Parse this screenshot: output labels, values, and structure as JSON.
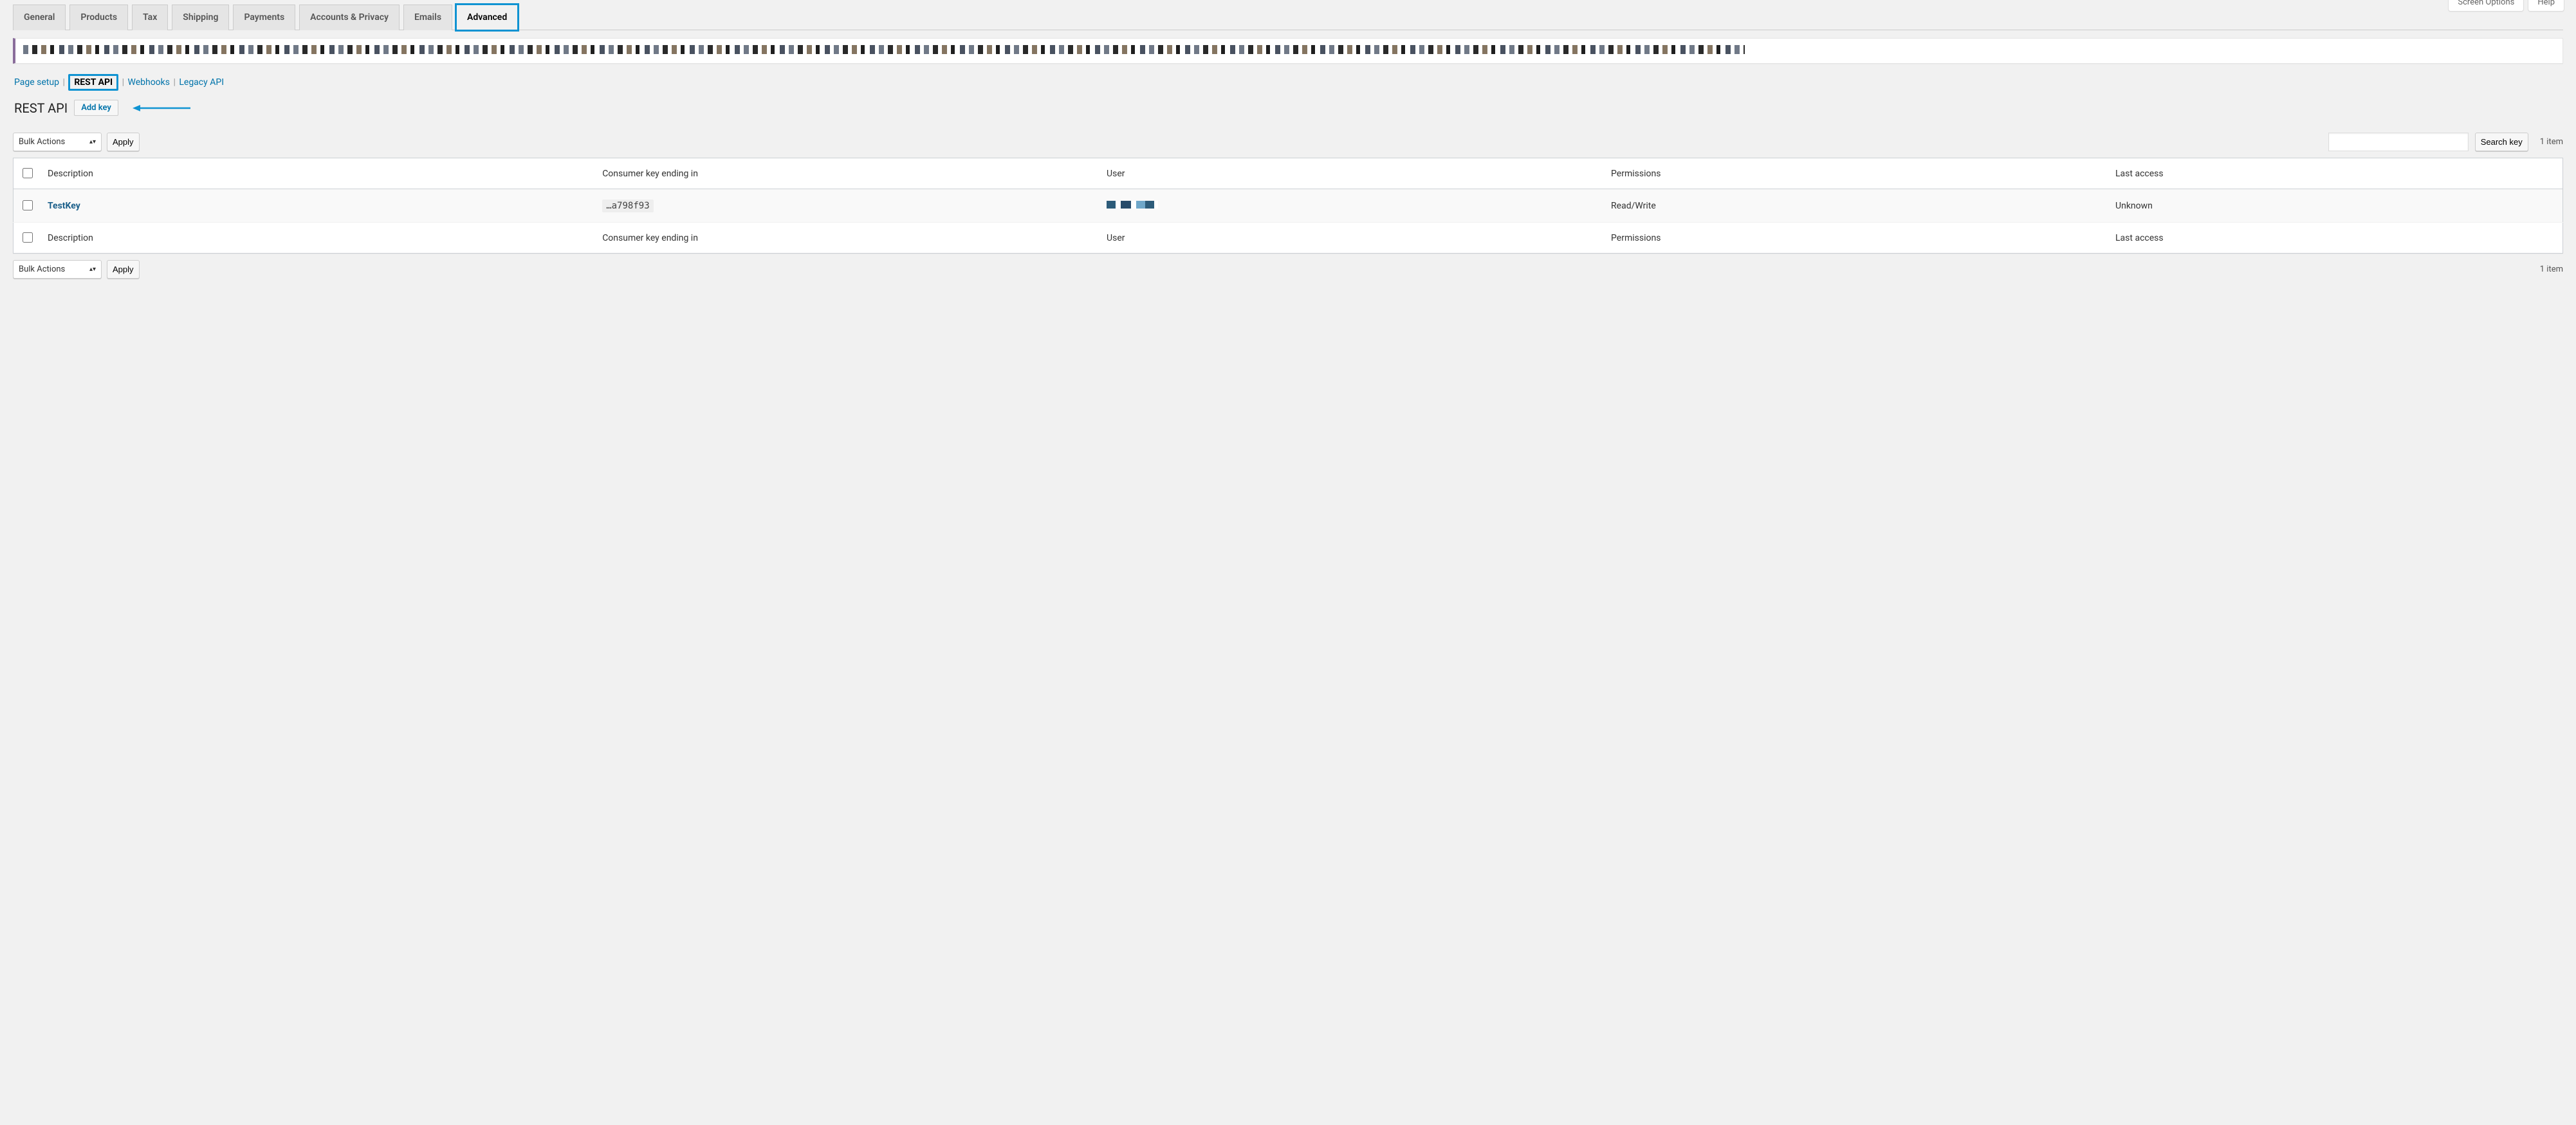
{
  "top_right": {
    "screen_options": "Screen Options",
    "help": "Help"
  },
  "tabs": [
    {
      "label": "General",
      "active": false,
      "highlighted": false
    },
    {
      "label": "Products",
      "active": false,
      "highlighted": false
    },
    {
      "label": "Tax",
      "active": false,
      "highlighted": false
    },
    {
      "label": "Shipping",
      "active": false,
      "highlighted": false
    },
    {
      "label": "Payments",
      "active": false,
      "highlighted": false
    },
    {
      "label": "Accounts & Privacy",
      "active": false,
      "highlighted": false
    },
    {
      "label": "Emails",
      "active": false,
      "highlighted": false
    },
    {
      "label": "Advanced",
      "active": true,
      "highlighted": true
    }
  ],
  "subtabs": {
    "items": [
      {
        "label": "Page setup",
        "current": false
      },
      {
        "label": "REST API",
        "current": true
      },
      {
        "label": "Webhooks",
        "current": false
      },
      {
        "label": "Legacy API",
        "current": false
      }
    ]
  },
  "page_title": "REST API",
  "add_key_label": "Add key",
  "search": {
    "placeholder": "",
    "button": "Search key"
  },
  "bulk_actions": {
    "label": "Bulk Actions",
    "apply": "Apply"
  },
  "item_count_label": "1 item",
  "table": {
    "columns": {
      "description": "Description",
      "consumer_key": "Consumer key ending in",
      "user": "User",
      "permissions": "Permissions",
      "last_access": "Last access"
    },
    "rows": [
      {
        "description": "TestKey",
        "consumer_key_ending": "…a798f93",
        "user": "",
        "user_blurred": true,
        "permissions": "Read/Write",
        "last_access": "Unknown"
      }
    ]
  }
}
